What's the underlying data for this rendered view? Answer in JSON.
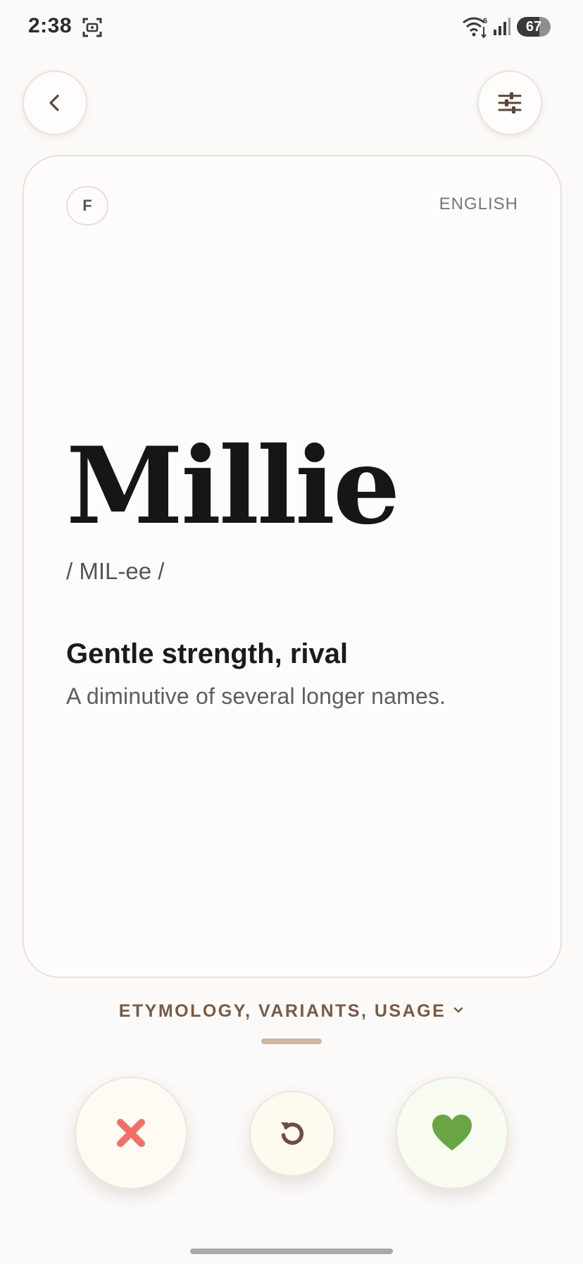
{
  "status_bar": {
    "time": "2:38",
    "wifi_badge": "6",
    "battery_level": "67",
    "battery_fraction": 0.67
  },
  "header": {
    "back_icon": "chevron-left-icon",
    "filter_icon": "sliders-icon"
  },
  "card": {
    "gender": "F",
    "origin": "ENGLISH",
    "name": "Millie",
    "pronunciation": "/ MIL-ee /",
    "meaning": "Gentle strength, rival",
    "description": "A diminutive of several longer names."
  },
  "details": {
    "label": "ETYMOLOGY, VARIANTS, USAGE",
    "icon": "chevron-down-icon"
  },
  "actions": {
    "reject_icon": "close-icon",
    "undo_icon": "undo-icon",
    "like_icon": "heart-icon"
  },
  "colors": {
    "background": "#fbfaf8",
    "accent_brown": "#7a5a44",
    "reject_red": "#f07068",
    "like_green": "#6aa544",
    "undo_brown": "#6b4e3c"
  }
}
